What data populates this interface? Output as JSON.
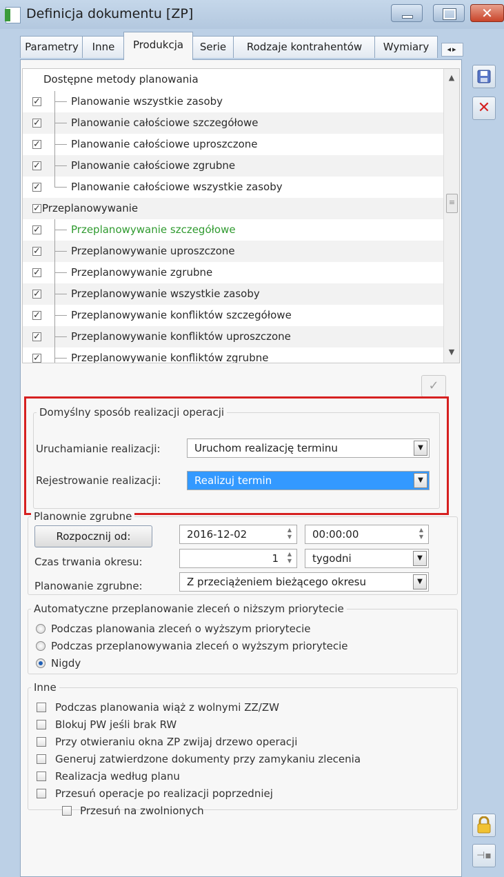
{
  "window": {
    "title": "Definicja dokumentu [ZP]"
  },
  "tabs": [
    "Parametry",
    "Inne",
    "Produkcja",
    "Serie",
    "Rodzaje kontrahentów",
    "Wymiary"
  ],
  "methods": {
    "header": "Dostępne metody planowania",
    "rows": [
      {
        "label": "Planowanie wszystkie zasoby",
        "checked": true
      },
      {
        "label": "Planowanie całościowe szczegółowe",
        "checked": true
      },
      {
        "label": "Planowanie całościowe uproszczone",
        "checked": true
      },
      {
        "label": "Planowanie całościowe zgrubne",
        "checked": true
      },
      {
        "label": "Planowanie całościowe wszystkie zasoby",
        "checked": true
      },
      {
        "label": "Przeplanowywanie",
        "checked": true
      },
      {
        "label": "Przeplanowywanie szczegółowe",
        "checked": true
      },
      {
        "label": "Przeplanowywanie uproszczone",
        "checked": true
      },
      {
        "label": "Przeplanowywanie zgrubne",
        "checked": true
      },
      {
        "label": "Przeplanowywanie wszystkie zasoby",
        "checked": true
      },
      {
        "label": "Przeplanowywanie konfliktów szczegółowe",
        "checked": true
      },
      {
        "label": "Przeplanowywanie konfliktów uproszczone",
        "checked": true
      },
      {
        "label": "Przeplanowywanie konfliktów zgrubne",
        "checked": true
      }
    ]
  },
  "default_realization": {
    "legend": "Domyślny sposób realizacji operacji",
    "start_label": "Uruchamianie realizacji:",
    "start_value": "Uruchom realizację terminu",
    "register_label": "Rejestrowanie realizacji:",
    "register_value": "Realizuj termin"
  },
  "rough": {
    "legend": "Planownie zgrubne",
    "start_button": "Rozpocznij od:",
    "date": "2016-12-02",
    "time": "00:00:00",
    "period_label": "Czas trwania okresu:",
    "period_value": "1",
    "period_unit": "tygodni",
    "planning_label": "Planowanie zgrubne:",
    "planning_value": "Z przeciążeniem bieżącego okresu"
  },
  "auto": {
    "legend": "Automatyczne przeplanowanie zleceń o niższym priorytecie",
    "options": [
      "Podczas planowania zleceń o wyższym priorytecie",
      "Podczas przeplanowywania zleceń o wyższym priorytecie",
      "Nigdy"
    ],
    "selected": 2
  },
  "other": {
    "legend": "Inne",
    "options": [
      "Podczas planowania wiąż z wolnymi ZZ/ZW",
      "Blokuj PW jeśli brak RW",
      "Przy otwieraniu okna ZP zwijaj drzewo operacji",
      "Generuj zatwierdzone dokumenty przy zamykaniu zlecenia",
      "Realizacja według planu",
      "Przesuń operacje po realizacji poprzedniej",
      "Przesuń na zwolnionych"
    ]
  },
  "colors": {
    "highlight": "#d62020",
    "green_text": "#2f9a2f",
    "selected": "#3399ff"
  }
}
